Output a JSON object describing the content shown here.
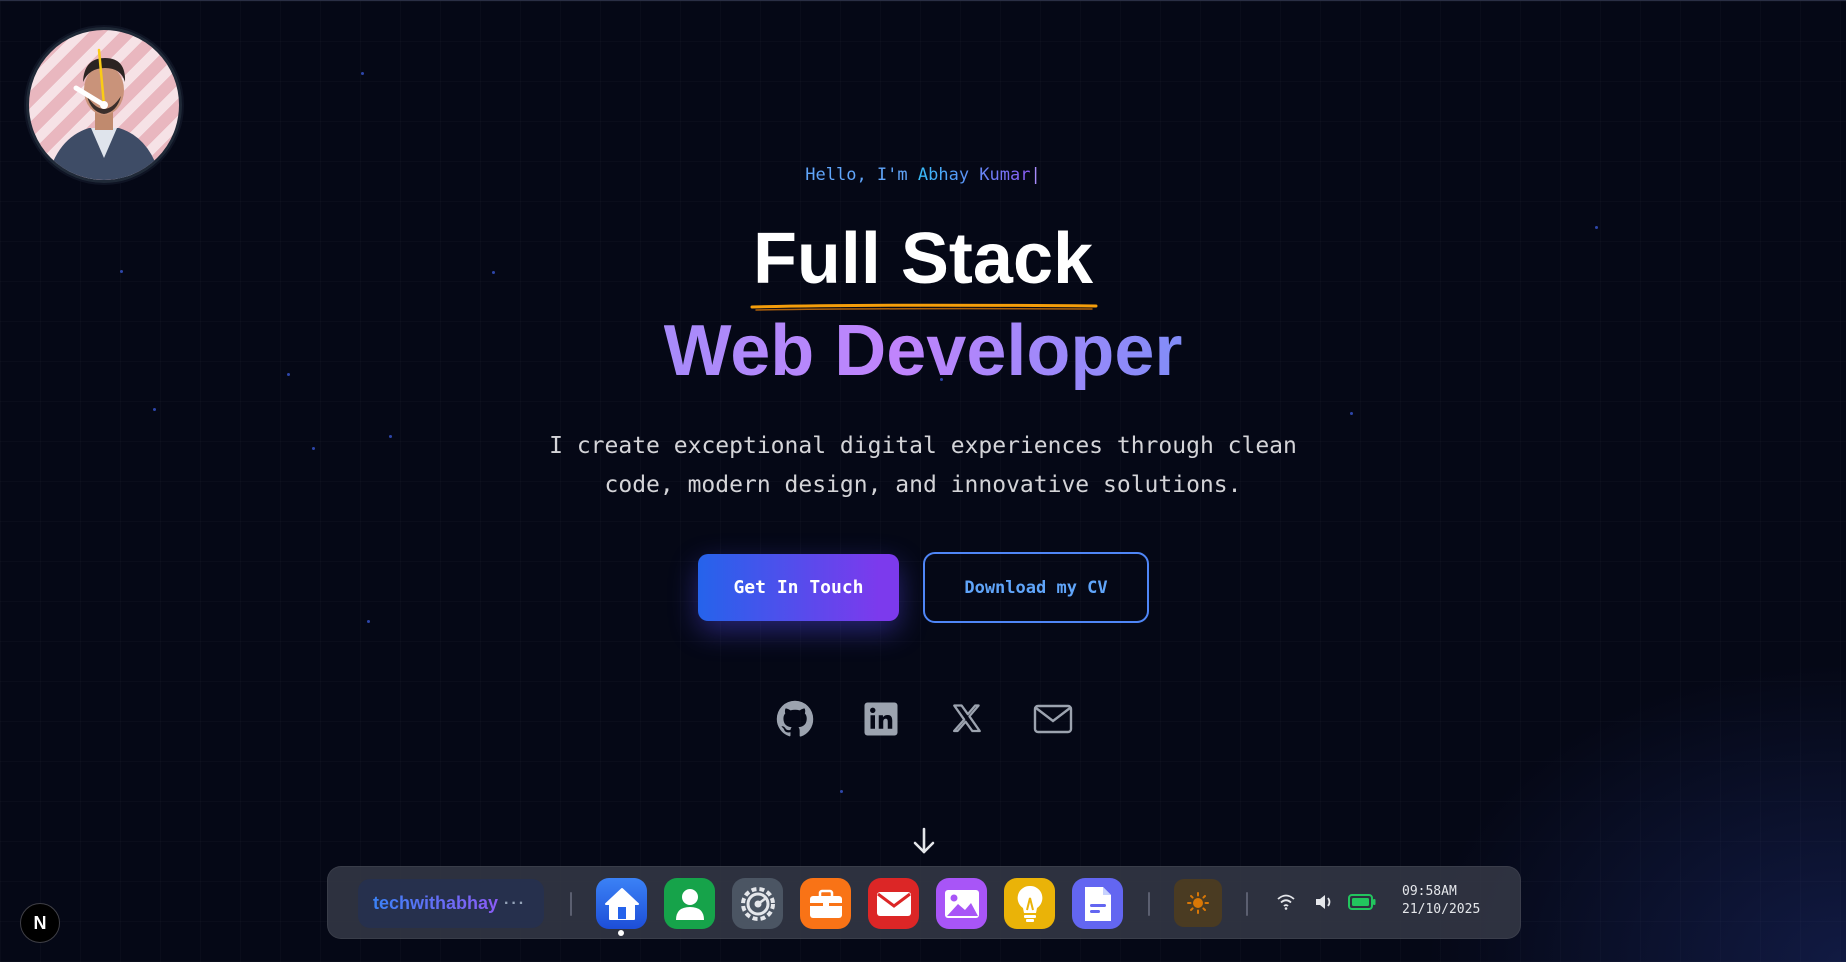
{
  "hero": {
    "greeting_prefix": "Hello, I'm ",
    "greeting_name": "Abhay Kumar",
    "cursor": "|",
    "title_line1": "Full Stack",
    "title_line2": "Web Developer",
    "tagline_line1": "I create exceptional digital experiences through clean",
    "tagline_line2": "code, modern design, and innovative solutions.",
    "primary_button": "Get In Touch",
    "secondary_button": "Download my CV"
  },
  "social": [
    "github-icon",
    "linkedin-icon",
    "x-icon",
    "mail-icon"
  ],
  "dock": {
    "brand": "techwithabhay",
    "brand_dots": "···",
    "apps": [
      "home",
      "about",
      "settings",
      "projects",
      "mail",
      "gallery",
      "ideas",
      "resume"
    ],
    "theme_icon": "sun-icon",
    "time": "09:58AM",
    "date": "21/10/2025"
  },
  "framework_badge": "N",
  "colors": {
    "background": "#050816",
    "accent_blue": "#2563eb",
    "accent_purple": "#7c3aed",
    "underline_orange": "#f59e0b"
  }
}
